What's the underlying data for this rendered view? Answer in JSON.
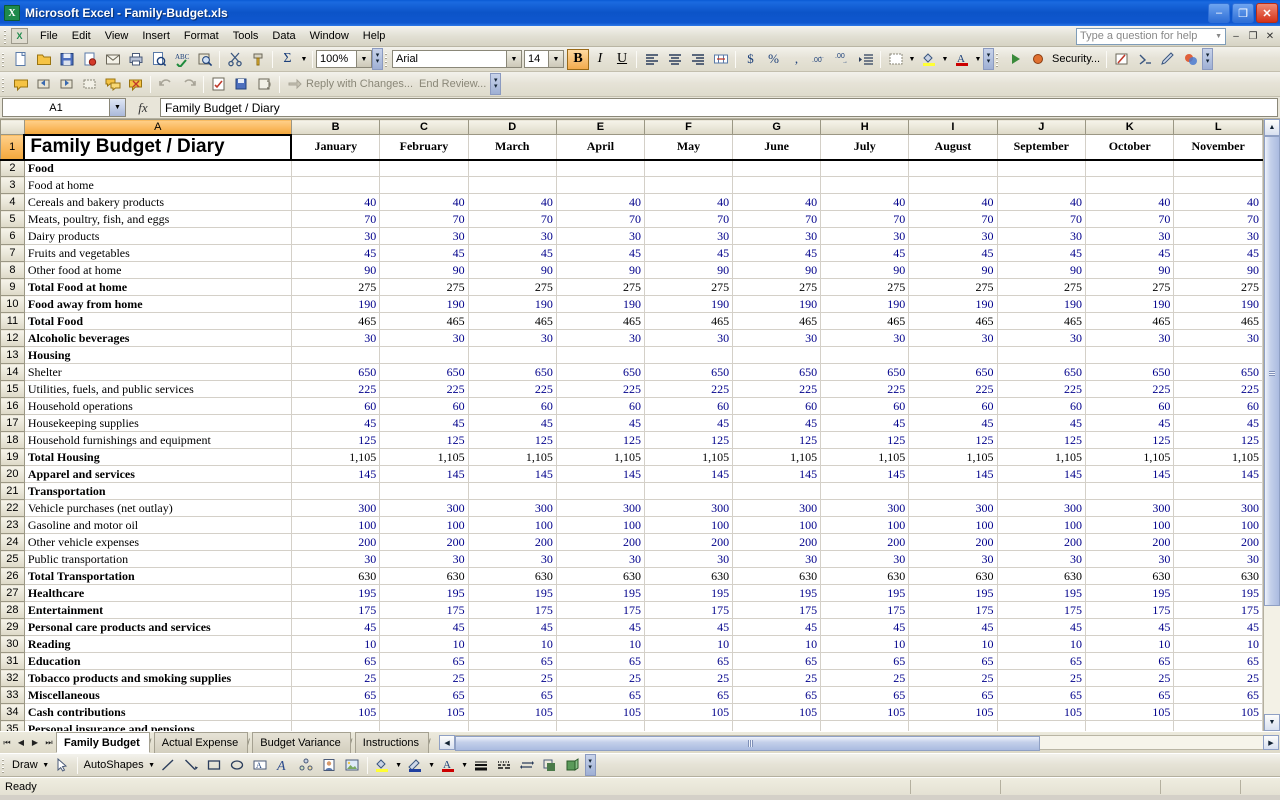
{
  "window": {
    "app_icon": "excel-icon",
    "title": "Microsoft Excel - Family-Budget.xls",
    "minimize": "–",
    "restore": "❐",
    "close": "✕"
  },
  "menubar": {
    "items": [
      "File",
      "Edit",
      "View",
      "Insert",
      "Format",
      "Tools",
      "Data",
      "Window",
      "Help"
    ],
    "help_placeholder": "Type a question for help",
    "doc_minimize": "–",
    "doc_restore": "❐",
    "doc_close": "✕"
  },
  "standard_toolbar": {
    "buttons": [
      "new-icon",
      "open-icon",
      "save-icon",
      "permission-icon",
      "email-icon",
      "print-icon",
      "print-preview-icon",
      "spelling-icon",
      "research-icon",
      "cut-icon",
      "format-painter-icon",
      "autosum-icon"
    ],
    "zoom_value": "100%"
  },
  "formatting_toolbar": {
    "font_name": "Arial",
    "font_size": "14",
    "bold": "B",
    "italic": "I",
    "underline": "U",
    "buttons": [
      "align-left-icon",
      "align-center-icon",
      "align-right-icon",
      "merge-center-icon",
      "currency-icon",
      "percent-icon",
      "comma-icon",
      "increase-decimal-icon",
      "decrease-decimal-icon",
      "indent-icon",
      "borders-icon",
      "fill-color-icon",
      "font-color-icon"
    ]
  },
  "reviewing_toolbar": {
    "reply_label": "Reply with Changes...",
    "end_review_label": "End Review..."
  },
  "vb_toolbar": {
    "security_label": "Security..."
  },
  "formula_bar": {
    "name_box": "A1",
    "fx": "fx",
    "content": "Family Budget / Diary"
  },
  "sheet": {
    "columns": [
      "A",
      "B",
      "C",
      "D",
      "E",
      "F",
      "G",
      "H",
      "I",
      "J",
      "K",
      "L"
    ],
    "selected_column": "A",
    "selected_row": "1",
    "title_cell": "Family Budget / Diary",
    "month_headers": [
      "January",
      "February",
      "March",
      "April",
      "May",
      "June",
      "July",
      "August",
      "September",
      "October",
      "November"
    ],
    "rows": [
      {
        "n": "2",
        "label": "Food",
        "style": "bold",
        "indent": 0,
        "values": [],
        "total": false
      },
      {
        "n": "3",
        "label": "Food at home",
        "style": "normal",
        "indent": 1,
        "values": [],
        "total": false
      },
      {
        "n": "4",
        "label": "Cereals and bakery products",
        "style": "normal",
        "indent": 2,
        "values": [
          40,
          40,
          40,
          40,
          40,
          40,
          40,
          40,
          40,
          40,
          40
        ],
        "total": false
      },
      {
        "n": "5",
        "label": "Meats, poultry, fish, and eggs",
        "style": "normal",
        "indent": 2,
        "values": [
          70,
          70,
          70,
          70,
          70,
          70,
          70,
          70,
          70,
          70,
          70
        ],
        "total": false
      },
      {
        "n": "6",
        "label": "Dairy products",
        "style": "normal",
        "indent": 2,
        "values": [
          30,
          30,
          30,
          30,
          30,
          30,
          30,
          30,
          30,
          30,
          30
        ],
        "total": false
      },
      {
        "n": "7",
        "label": "Fruits and vegetables",
        "style": "normal",
        "indent": 2,
        "values": [
          45,
          45,
          45,
          45,
          45,
          45,
          45,
          45,
          45,
          45,
          45
        ],
        "total": false
      },
      {
        "n": "8",
        "label": "Other food at home",
        "style": "normal",
        "indent": 2,
        "values": [
          90,
          90,
          90,
          90,
          90,
          90,
          90,
          90,
          90,
          90,
          90
        ],
        "total": false
      },
      {
        "n": "9",
        "label": "Total Food at home",
        "style": "bold",
        "indent": 1,
        "values": [
          275,
          275,
          275,
          275,
          275,
          275,
          275,
          275,
          275,
          275,
          275
        ],
        "total": true
      },
      {
        "n": "10",
        "label": "Food away from home",
        "style": "bold",
        "indent": 1,
        "values": [
          190,
          190,
          190,
          190,
          190,
          190,
          190,
          190,
          190,
          190,
          190
        ],
        "total": false
      },
      {
        "n": "11",
        "label": "Total Food",
        "style": "bold",
        "indent": 0,
        "values": [
          465,
          465,
          465,
          465,
          465,
          465,
          465,
          465,
          465,
          465,
          465
        ],
        "total": true
      },
      {
        "n": "12",
        "label": "Alcoholic beverages",
        "style": "bold",
        "indent": 0,
        "values": [
          30,
          30,
          30,
          30,
          30,
          30,
          30,
          30,
          30,
          30,
          30
        ],
        "total": false
      },
      {
        "n": "13",
        "label": "Housing",
        "style": "bold",
        "indent": 0,
        "values": [],
        "total": false
      },
      {
        "n": "14",
        "label": "Shelter",
        "style": "normal",
        "indent": 1,
        "values": [
          650,
          650,
          650,
          650,
          650,
          650,
          650,
          650,
          650,
          650,
          650
        ],
        "total": false
      },
      {
        "n": "15",
        "label": "Utilities, fuels, and public services",
        "style": "normal",
        "indent": 1,
        "values": [
          225,
          225,
          225,
          225,
          225,
          225,
          225,
          225,
          225,
          225,
          225
        ],
        "total": false
      },
      {
        "n": "16",
        "label": "Household operations",
        "style": "normal",
        "indent": 1,
        "values": [
          60,
          60,
          60,
          60,
          60,
          60,
          60,
          60,
          60,
          60,
          60
        ],
        "total": false
      },
      {
        "n": "17",
        "label": "Housekeeping supplies",
        "style": "normal",
        "indent": 1,
        "values": [
          45,
          45,
          45,
          45,
          45,
          45,
          45,
          45,
          45,
          45,
          45
        ],
        "total": false
      },
      {
        "n": "18",
        "label": "Household furnishings and equipment",
        "style": "normal",
        "indent": 1,
        "values": [
          125,
          125,
          125,
          125,
          125,
          125,
          125,
          125,
          125,
          125,
          125
        ],
        "total": false
      },
      {
        "n": "19",
        "label": "Total Housing",
        "style": "bold",
        "indent": 0,
        "values": [
          "1,105",
          "1,105",
          "1,105",
          "1,105",
          "1,105",
          "1,105",
          "1,105",
          "1,105",
          "1,105",
          "1,105",
          "1,105"
        ],
        "total": true
      },
      {
        "n": "20",
        "label": "Apparel and services",
        "style": "bold",
        "indent": 0,
        "values": [
          145,
          145,
          145,
          145,
          145,
          145,
          145,
          145,
          145,
          145,
          145
        ],
        "total": false
      },
      {
        "n": "21",
        "label": "Transportation",
        "style": "bold",
        "indent": 0,
        "values": [],
        "total": false
      },
      {
        "n": "22",
        "label": "Vehicle purchases (net outlay)",
        "style": "normal",
        "indent": 1,
        "values": [
          300,
          300,
          300,
          300,
          300,
          300,
          300,
          300,
          300,
          300,
          300
        ],
        "total": false
      },
      {
        "n": "23",
        "label": "Gasoline and motor oil",
        "style": "normal",
        "indent": 1,
        "values": [
          100,
          100,
          100,
          100,
          100,
          100,
          100,
          100,
          100,
          100,
          100
        ],
        "total": false
      },
      {
        "n": "24",
        "label": "Other vehicle expenses",
        "style": "normal",
        "indent": 1,
        "values": [
          200,
          200,
          200,
          200,
          200,
          200,
          200,
          200,
          200,
          200,
          200
        ],
        "total": false
      },
      {
        "n": "25",
        "label": "Public transportation",
        "style": "normal",
        "indent": 1,
        "values": [
          30,
          30,
          30,
          30,
          30,
          30,
          30,
          30,
          30,
          30,
          30
        ],
        "total": false
      },
      {
        "n": "26",
        "label": "Total Transportation",
        "style": "bold",
        "indent": 0,
        "values": [
          630,
          630,
          630,
          630,
          630,
          630,
          630,
          630,
          630,
          630,
          630
        ],
        "total": true
      },
      {
        "n": "27",
        "label": "Healthcare",
        "style": "bold",
        "indent": 0,
        "values": [
          195,
          195,
          195,
          195,
          195,
          195,
          195,
          195,
          195,
          195,
          195
        ],
        "total": false
      },
      {
        "n": "28",
        "label": "Entertainment",
        "style": "bold",
        "indent": 0,
        "values": [
          175,
          175,
          175,
          175,
          175,
          175,
          175,
          175,
          175,
          175,
          175
        ],
        "total": false
      },
      {
        "n": "29",
        "label": "Personal care products and services",
        "style": "bold",
        "indent": 0,
        "values": [
          45,
          45,
          45,
          45,
          45,
          45,
          45,
          45,
          45,
          45,
          45
        ],
        "total": false
      },
      {
        "n": "30",
        "label": "Reading",
        "style": "bold",
        "indent": 0,
        "values": [
          10,
          10,
          10,
          10,
          10,
          10,
          10,
          10,
          10,
          10,
          10
        ],
        "total": false
      },
      {
        "n": "31",
        "label": "Education",
        "style": "bold",
        "indent": 0,
        "values": [
          65,
          65,
          65,
          65,
          65,
          65,
          65,
          65,
          65,
          65,
          65
        ],
        "total": false
      },
      {
        "n": "32",
        "label": "Tobacco products and smoking supplies",
        "style": "bold",
        "indent": 0,
        "values": [
          25,
          25,
          25,
          25,
          25,
          25,
          25,
          25,
          25,
          25,
          25
        ],
        "total": false
      },
      {
        "n": "33",
        "label": "Miscellaneous",
        "style": "bold",
        "indent": 0,
        "values": [
          65,
          65,
          65,
          65,
          65,
          65,
          65,
          65,
          65,
          65,
          65
        ],
        "total": false
      },
      {
        "n": "34",
        "label": "Cash contributions",
        "style": "bold",
        "indent": 0,
        "values": [
          105,
          105,
          105,
          105,
          105,
          105,
          105,
          105,
          105,
          105,
          105
        ],
        "total": false
      },
      {
        "n": "35",
        "label": "Personal insurance and pensions",
        "style": "bold",
        "indent": 0,
        "values": [],
        "total": false
      }
    ]
  },
  "sheet_tabs": {
    "first": "⏮",
    "prev": "◀",
    "next": "▶",
    "last": "⏭",
    "tabs": [
      {
        "label": "Family Budget",
        "active": true
      },
      {
        "label": "Actual Expense",
        "active": false
      },
      {
        "label": "Budget Variance",
        "active": false
      },
      {
        "label": "Instructions",
        "active": false
      }
    ]
  },
  "drawing_toolbar": {
    "draw_label": "Draw",
    "autoshapes_label": "AutoShapes",
    "tools": [
      "select-arrow-icon",
      "line-icon",
      "arrow-icon",
      "rectangle-icon",
      "oval-icon",
      "textbox-icon",
      "wordart-icon",
      "diagram-icon",
      "clipart-icon",
      "picture-icon",
      "fill-color-icon",
      "line-color-icon",
      "font-color-icon",
      "line-style-icon",
      "dash-style-icon",
      "arrow-style-icon",
      "shadow-icon",
      "3d-icon"
    ]
  },
  "status_bar": {
    "text": "Ready"
  },
  "colors": {
    "titlebar_blue": "#0c54c8",
    "header_orange": "#f2a83c",
    "input_blue": "#00008B",
    "toolbar_bg": "#e6e3d7"
  }
}
